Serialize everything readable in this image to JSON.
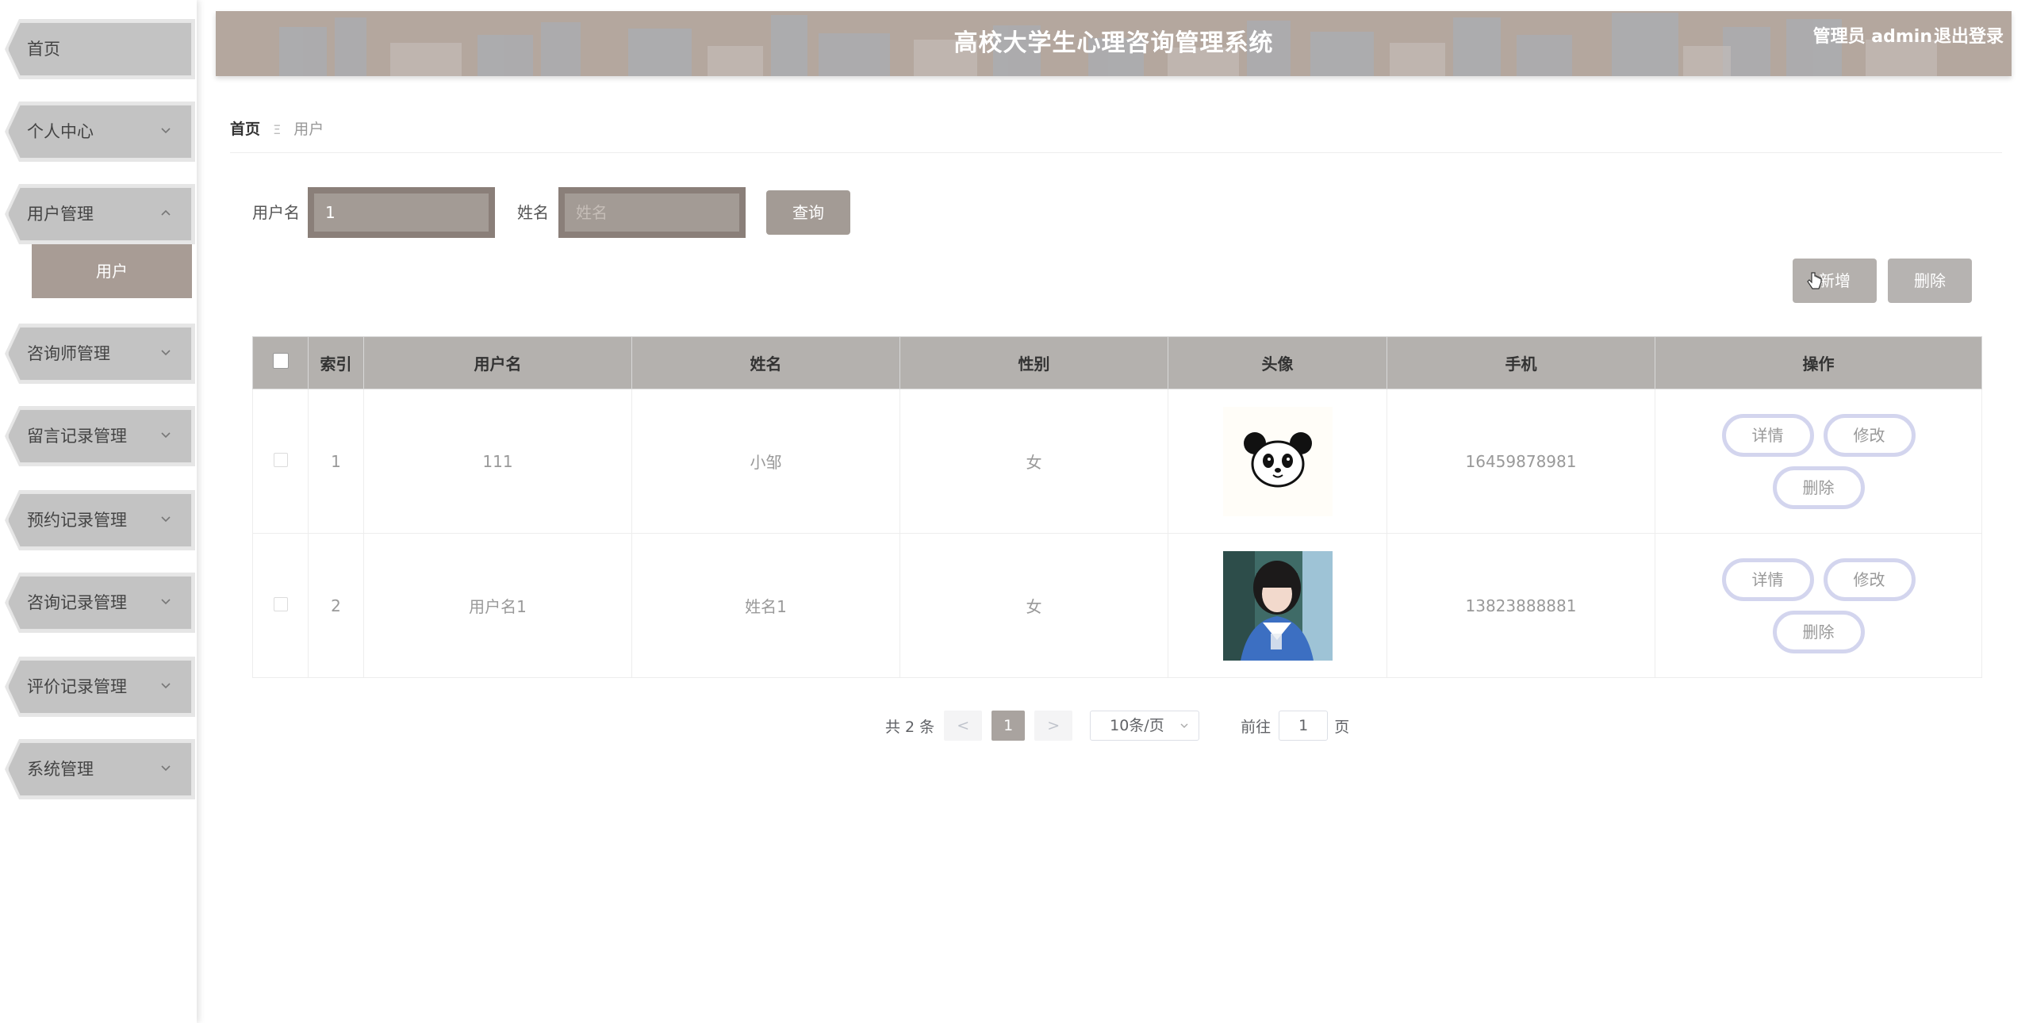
{
  "sidebar": {
    "items": [
      {
        "label": "首页",
        "expandable": false
      },
      {
        "label": "个人中心",
        "expandable": true
      },
      {
        "label": "用户管理",
        "expandable": true,
        "expanded": true
      },
      {
        "label": "咨询师管理",
        "expandable": true
      },
      {
        "label": "留言记录管理",
        "expandable": true
      },
      {
        "label": "预约记录管理",
        "expandable": true
      },
      {
        "label": "咨询记录管理",
        "expandable": true
      },
      {
        "label": "评价记录管理",
        "expandable": true
      },
      {
        "label": "系统管理",
        "expandable": true
      }
    ],
    "submenu": {
      "label": "用户",
      "active": true
    }
  },
  "header": {
    "title": "高校大学生心理咨询管理系统",
    "user": "管理员 admin",
    "logout": "退出登录"
  },
  "breadcrumb": {
    "home": "首页",
    "separator": "Ξ",
    "current": "用户"
  },
  "search": {
    "username_label": "用户名",
    "username_value": "1",
    "name_label": "姓名",
    "name_placeholder": "姓名",
    "query_button": "查询"
  },
  "actions": {
    "add_button": "新增",
    "delete_button": "删除"
  },
  "table": {
    "headers": [
      "",
      "索引",
      "用户名",
      "姓名",
      "性别",
      "头像",
      "手机",
      "操作"
    ],
    "rows": [
      {
        "index": "1",
        "username": "111",
        "name": "小邹",
        "gender": "女",
        "avatar": "panda-avatar",
        "phone": "16459878981"
      },
      {
        "index": "2",
        "username": "用户名1",
        "name": "姓名1",
        "gender": "女",
        "avatar": "girl-photo-avatar",
        "phone": "13823888881"
      }
    ],
    "op_labels": {
      "detail": "详情",
      "edit": "修改",
      "delete": "删除"
    }
  },
  "pagination": {
    "total": "共 2 条",
    "prev": "<",
    "current": "1",
    "next": ">",
    "page_size": "10条/页",
    "goto_label": "前往",
    "goto_value": "1",
    "page_suffix": "页"
  },
  "colors": {
    "header_bg": "#b4a79e",
    "sidebar_item": "#c3c3c3",
    "submenu_active": "#a89c95",
    "table_header": "#b4b1ae",
    "op_border": "#d3d5ee"
  }
}
